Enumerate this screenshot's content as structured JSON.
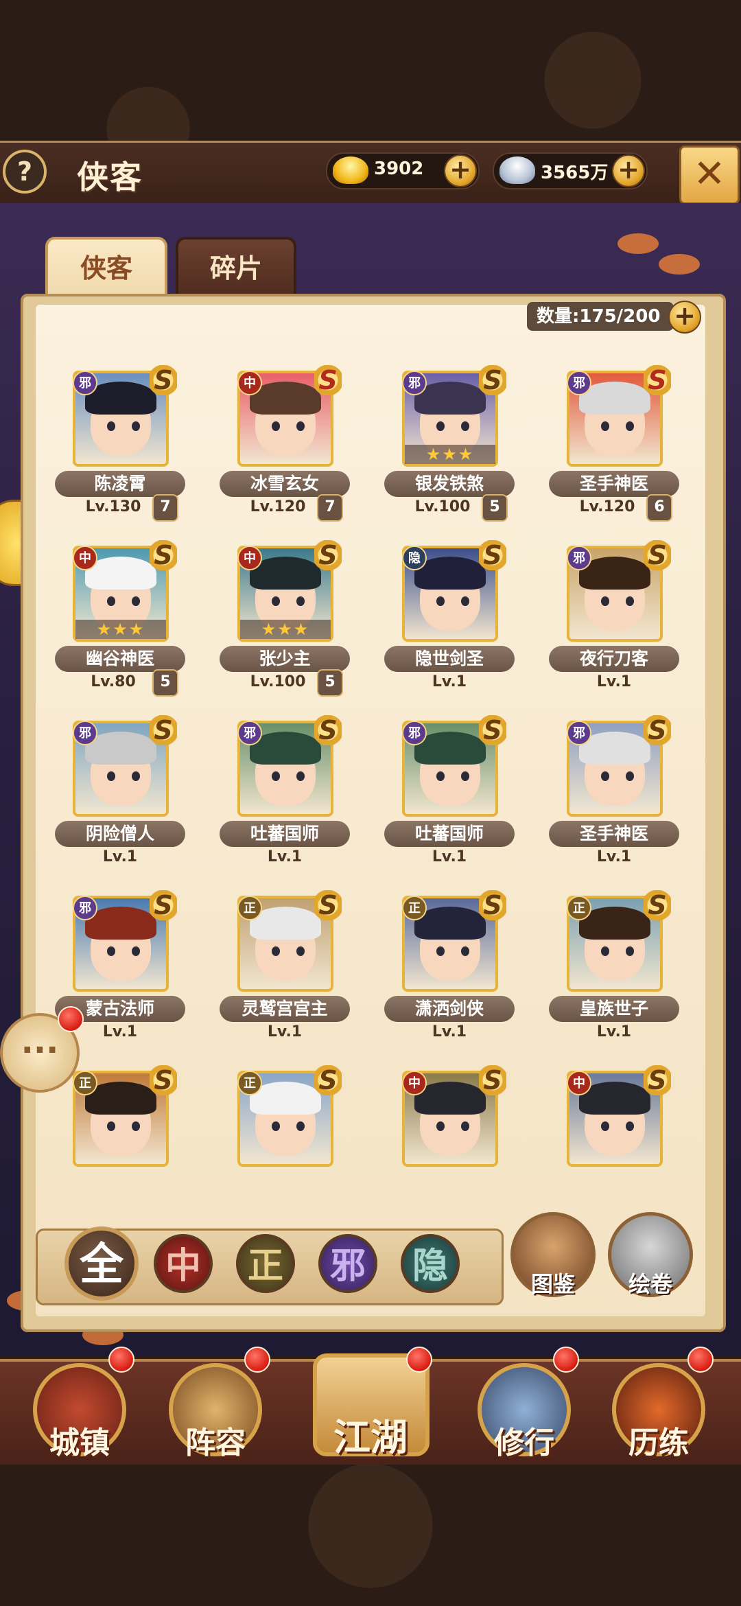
{
  "header": {
    "help_label": "?",
    "title": "侠客",
    "gold_amount": "3902",
    "silver_amount": "3565万",
    "plus_symbol": "+",
    "close_icon": "crossed-swords-icon"
  },
  "tabs": [
    {
      "label": "侠客",
      "active": true
    },
    {
      "label": "碎片",
      "active": false
    }
  ],
  "hero_count": "数量:175/200",
  "heroes": [
    {
      "name": "陈凌霄",
      "level": "Lv.130",
      "count": "7",
      "faction": "邪",
      "stars": "",
      "tier": "S"
    },
    {
      "name": "冰雪玄女",
      "level": "Lv.120",
      "count": "7",
      "faction": "中",
      "stars": "",
      "tier": "S"
    },
    {
      "name": "银发铁煞",
      "level": "Lv.100",
      "count": "5",
      "faction": "邪",
      "stars": "★★★",
      "tier": "S"
    },
    {
      "name": "圣手神医",
      "level": "Lv.120",
      "count": "6",
      "faction": "邪",
      "stars": "",
      "tier": "S"
    },
    {
      "name": "幽谷神医",
      "level": "Lv.80",
      "count": "5",
      "faction": "中",
      "stars": "★★★",
      "tier": "S"
    },
    {
      "name": "张少主",
      "level": "Lv.100",
      "count": "5",
      "faction": "中",
      "stars": "★★★",
      "tier": "S"
    },
    {
      "name": "隐世剑圣",
      "level": "Lv.1",
      "count": "",
      "faction": "隐",
      "stars": "",
      "tier": "S"
    },
    {
      "name": "夜行刀客",
      "level": "Lv.1",
      "count": "",
      "faction": "邪",
      "stars": "",
      "tier": "S"
    },
    {
      "name": "阴险僧人",
      "level": "Lv.1",
      "count": "",
      "faction": "邪",
      "stars": "",
      "tier": "S"
    },
    {
      "name": "吐蕃国师",
      "level": "Lv.1",
      "count": "",
      "faction": "邪",
      "stars": "",
      "tier": "S"
    },
    {
      "name": "吐蕃国师",
      "level": "Lv.1",
      "count": "",
      "faction": "邪",
      "stars": "",
      "tier": "S"
    },
    {
      "name": "圣手神医",
      "level": "Lv.1",
      "count": "",
      "faction": "邪",
      "stars": "",
      "tier": "S"
    },
    {
      "name": "蒙古法师",
      "level": "Lv.1",
      "count": "",
      "faction": "邪",
      "stars": "",
      "tier": "S"
    },
    {
      "name": "灵鹫宫宫主",
      "level": "Lv.1",
      "count": "",
      "faction": "正",
      "stars": "",
      "tier": "S"
    },
    {
      "name": "潇洒剑侠",
      "level": "Lv.1",
      "count": "",
      "faction": "正",
      "stars": "",
      "tier": "S"
    },
    {
      "name": "皇族世子",
      "level": "Lv.1",
      "count": "",
      "faction": "正",
      "stars": "",
      "tier": "S"
    },
    {
      "name": "",
      "level": "",
      "count": "",
      "faction": "正",
      "stars": "",
      "tier": "S"
    },
    {
      "name": "",
      "level": "",
      "count": "",
      "faction": "正",
      "stars": "",
      "tier": "S"
    },
    {
      "name": "",
      "level": "",
      "count": "",
      "faction": "中",
      "stars": "",
      "tier": "S"
    },
    {
      "name": "",
      "level": "",
      "count": "",
      "faction": "中",
      "stars": "",
      "tier": "S"
    }
  ],
  "filters": [
    {
      "label": "全"
    },
    {
      "label": "中"
    },
    {
      "label": "正"
    },
    {
      "label": "邪"
    },
    {
      "label": "隐"
    }
  ],
  "side_buttons": {
    "tujian": "图鉴",
    "huijuan": "绘卷"
  },
  "chat_icon": "···",
  "bottom_nav": [
    {
      "label": "城镇"
    },
    {
      "label": "阵容"
    },
    {
      "label": "江湖"
    },
    {
      "label": "修行"
    },
    {
      "label": "历练"
    }
  ],
  "colors": {
    "accent_gold": "#e7b43a",
    "panel_bg": "#fbf1dd",
    "header_bg": "#4a2d22"
  }
}
